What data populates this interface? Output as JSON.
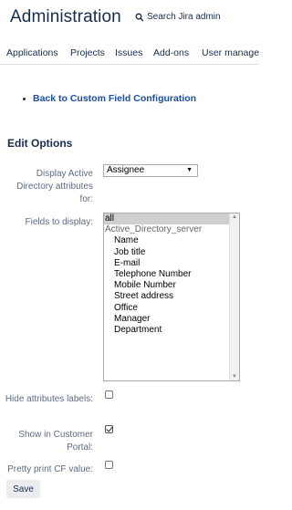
{
  "header": {
    "title": "Administration",
    "search_label": "Search Jira admin"
  },
  "nav": {
    "items": [
      "Applications",
      "Projects",
      "Issues",
      "Add-ons",
      "User managem"
    ]
  },
  "back_link": "Back to Custom Field Configuration",
  "section_title": "Edit Options",
  "form": {
    "display_attr_label": "Display Active Directory attributes for:",
    "display_attr_value": "Assignee",
    "fields_label": "Fields to display:",
    "fields_options": {
      "all": "all",
      "group": "Active_Directory_server",
      "children": [
        "Name",
        "Job title",
        "E-mail",
        "Telephone Number",
        "Mobile Number",
        "Street address",
        "Office",
        "Manager",
        "Department"
      ]
    },
    "hide_labels_label": "Hide attributes labels:",
    "hide_labels_checked": false,
    "customer_portal_label": "Show in Customer Portal:",
    "customer_portal_checked": true,
    "pretty_print_label": "Pretty print CF value:",
    "pretty_print_checked": false,
    "save_label": "Save"
  }
}
